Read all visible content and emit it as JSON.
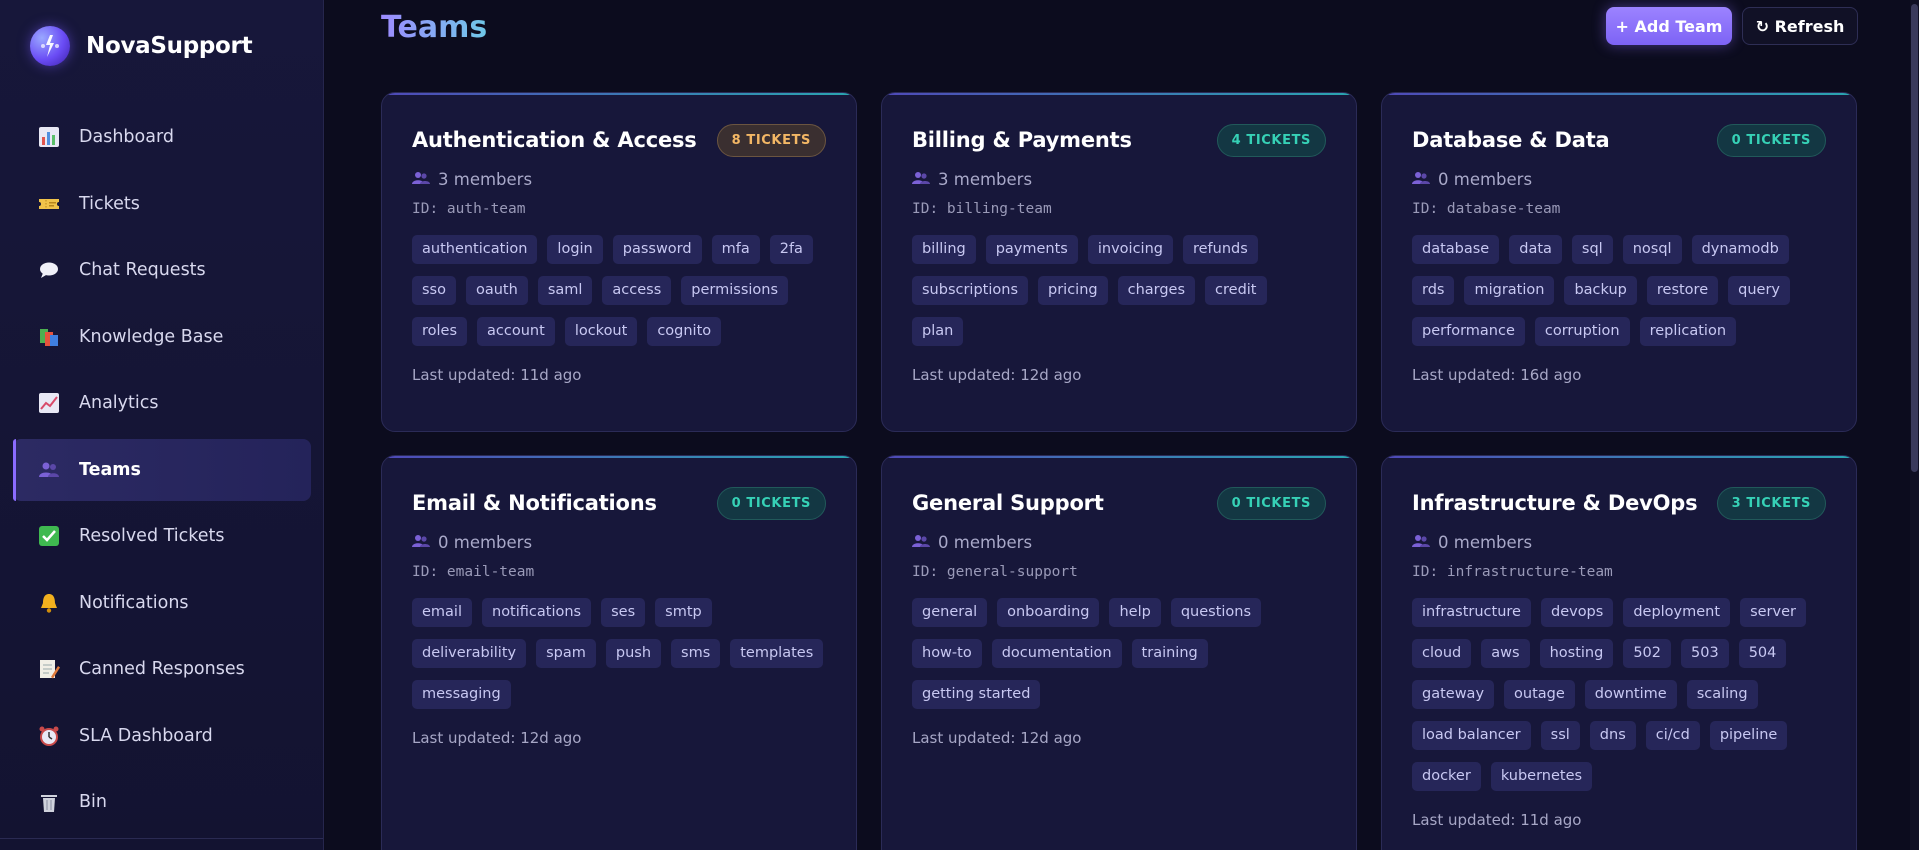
{
  "app": {
    "name": "NovaSupport"
  },
  "sidebar": {
    "items": [
      {
        "label": "Dashboard",
        "icon": "bar-chart-icon",
        "active": false
      },
      {
        "label": "Tickets",
        "icon": "ticket-icon",
        "active": false
      },
      {
        "label": "Chat Requests",
        "icon": "chat-bubble-icon",
        "active": false
      },
      {
        "label": "Knowledge Base",
        "icon": "books-icon",
        "active": false
      },
      {
        "label": "Analytics",
        "icon": "trend-chart-icon",
        "active": false
      },
      {
        "label": "Teams",
        "icon": "people-icon",
        "active": true
      },
      {
        "label": "Resolved Tickets",
        "icon": "checkmark-icon",
        "active": false
      },
      {
        "label": "Notifications",
        "icon": "bell-icon",
        "active": false
      },
      {
        "label": "Canned Responses",
        "icon": "memo-icon",
        "active": false
      },
      {
        "label": "SLA Dashboard",
        "icon": "alarm-clock-icon",
        "active": false
      },
      {
        "label": "Bin",
        "icon": "trash-icon",
        "active": false
      }
    ]
  },
  "header": {
    "title": "Teams",
    "add_label": "+ Add Team",
    "refresh_label": "↻ Refresh"
  },
  "teams": [
    {
      "name": "Authentication & Access",
      "tickets": "8 TICKETS",
      "badge_status": "warn",
      "members": "3 members",
      "id": "ID: auth-team",
      "tags": [
        "authentication",
        "login",
        "password",
        "mfa",
        "2fa",
        "sso",
        "oauth",
        "saml",
        "access",
        "permissions",
        "roles",
        "account",
        "lockout",
        "cognito"
      ],
      "updated": "Last updated: 11d ago"
    },
    {
      "name": "Billing & Payments",
      "tickets": "4 TICKETS",
      "badge_status": "ok",
      "members": "3 members",
      "id": "ID: billing-team",
      "tags": [
        "billing",
        "payments",
        "invoicing",
        "refunds",
        "subscriptions",
        "pricing",
        "charges",
        "credit",
        "plan"
      ],
      "updated": "Last updated: 12d ago"
    },
    {
      "name": "Database & Data",
      "tickets": "0 TICKETS",
      "badge_status": "ok",
      "members": "0 members",
      "id": "ID: database-team",
      "tags": [
        "database",
        "data",
        "sql",
        "nosql",
        "dynamodb",
        "rds",
        "migration",
        "backup",
        "restore",
        "query",
        "performance",
        "corruption",
        "replication"
      ],
      "updated": "Last updated: 16d ago"
    },
    {
      "name": "Email & Notifications",
      "tickets": "0 TICKETS",
      "badge_status": "ok",
      "members": "0 members",
      "id": "ID: email-team",
      "tags": [
        "email",
        "notifications",
        "ses",
        "smtp",
        "deliverability",
        "spam",
        "push",
        "sms",
        "templates",
        "messaging"
      ],
      "updated": "Last updated: 12d ago"
    },
    {
      "name": "General Support",
      "tickets": "0 TICKETS",
      "badge_status": "ok",
      "members": "0 members",
      "id": "ID: general-support",
      "tags": [
        "general",
        "onboarding",
        "help",
        "questions",
        "how-to",
        "documentation",
        "training",
        "getting started"
      ],
      "updated": "Last updated: 12d ago"
    },
    {
      "name": "Infrastructure & DevOps",
      "tickets": "3 TICKETS",
      "badge_status": "ok",
      "members": "0 members",
      "id": "ID: infrastructure-team",
      "tags": [
        "infrastructure",
        "devops",
        "deployment",
        "server",
        "cloud",
        "aws",
        "hosting",
        "502",
        "503",
        "504",
        "gateway",
        "outage",
        "downtime",
        "scaling",
        "load balancer",
        "ssl",
        "dns",
        "ci/cd",
        "pipeline",
        "docker",
        "kubernetes"
      ],
      "updated": "Last updated: 11d ago"
    }
  ],
  "colors": {
    "accent": "#8b6cff",
    "badge_warn": "#f3b765",
    "badge_ok": "#36d1b6",
    "background": "#0c0c1e",
    "card": "#17173a"
  }
}
